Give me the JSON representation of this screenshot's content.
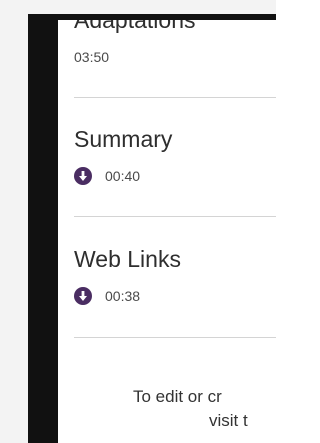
{
  "items": [
    {
      "title": "Adaptations",
      "duration": "03:50",
      "has_download": false
    },
    {
      "title": "Summary",
      "duration": "00:40",
      "has_download": true,
      "icon": "download-icon"
    },
    {
      "title": "Web Links",
      "duration": "00:38",
      "has_download": true,
      "icon": "download-icon"
    }
  ],
  "footer": {
    "line1": "To edit or cr",
    "line2": "visit t"
  },
  "colors": {
    "accent": "#4a2d62",
    "bezel": "#111111",
    "divider": "#d4d4d4"
  }
}
